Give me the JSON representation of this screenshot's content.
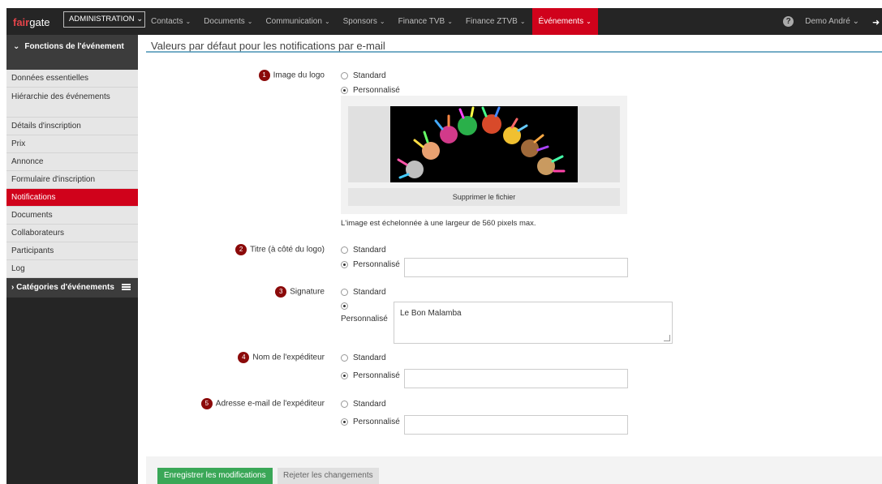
{
  "app": {
    "logo_left": "fair",
    "logo_right": "gate",
    "admin_label": "ADMINISTRATION"
  },
  "nav": {
    "items": [
      {
        "label": "Contacts"
      },
      {
        "label": "Documents"
      },
      {
        "label": "Communication"
      },
      {
        "label": "Sponsors"
      },
      {
        "label": "Finance TVB"
      },
      {
        "label": "Finance ZTVB"
      },
      {
        "label": "Événements"
      }
    ],
    "active_index": 6,
    "user": "Demo André"
  },
  "sidebar": {
    "header": "Fonctions de l'événement",
    "items": [
      {
        "label": "Données essentielles"
      },
      {
        "label": "Hiérarchie des événements"
      },
      {
        "label": "Détails d'inscription"
      },
      {
        "label": "Prix"
      },
      {
        "label": "Annonce"
      },
      {
        "label": "Formulaire d'inscription"
      },
      {
        "label": "Notifications"
      },
      {
        "label": "Documents"
      },
      {
        "label": "Collaborateurs"
      },
      {
        "label": "Participants"
      },
      {
        "label": "Log"
      }
    ],
    "active_index": 6,
    "category": "Catégories d'événements"
  },
  "main": {
    "title": "Valeurs par défaut pour les notifications par e-mail",
    "fields": [
      {
        "num": "1",
        "label": "Image du logo",
        "option_standard": "Standard",
        "option_custom": "Personnalisé",
        "selected": "custom"
      },
      {
        "num": "2",
        "label": "Titre (à côté du logo)",
        "option_standard": "Standard",
        "option_custom": "Personnalisé",
        "selected": "custom",
        "value": ""
      },
      {
        "num": "3",
        "label": "Signature",
        "option_standard": "Standard",
        "option_custom": "Personnalisé",
        "selected": "custom",
        "value": "Le Bon Malamba"
      },
      {
        "num": "4",
        "label": "Nom de l'expéditeur",
        "option_standard": "Standard",
        "option_custom": "Personnalisé",
        "selected": "custom",
        "value": ""
      },
      {
        "num": "5",
        "label": "Adresse e-mail de l'expéditeur",
        "option_standard": "Standard",
        "option_custom": "Personnalisé",
        "selected": "custom",
        "value": ""
      }
    ],
    "delete_file_label": "Supprimer le fichier",
    "image_hint": "L'image est échelonnée à une largeur de 560 pixels max."
  },
  "footer": {
    "save_label": "Enregistrer les modifications",
    "reject_label": "Rejeter les changements"
  },
  "colors": {
    "accent": "#d0021b",
    "navbar": "#252525",
    "save": "#3aa757",
    "badge": "#8b0a0a"
  }
}
